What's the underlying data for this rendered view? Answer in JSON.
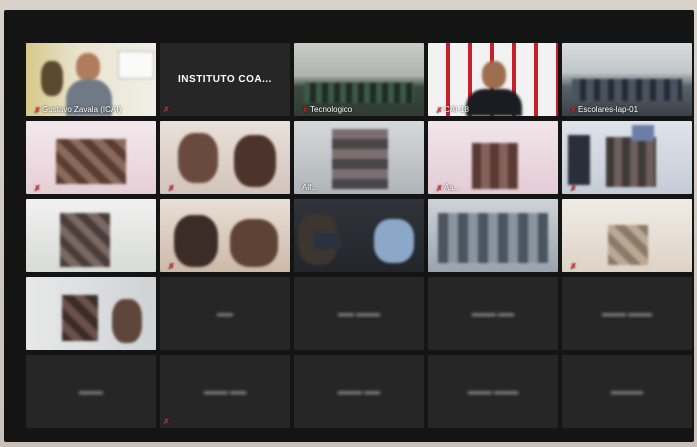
{
  "meeting": {
    "participants": [
      {
        "name": "Gustavo Zavala (ICAI)",
        "type": "video",
        "active": true,
        "muted": true
      },
      {
        "name": "INSTITUTO  COA...",
        "type": "name-only",
        "muted": true
      },
      {
        "name": "Tecnologico",
        "type": "video",
        "muted": true
      },
      {
        "name": "CAI-18",
        "type": "video",
        "muted": true
      },
      {
        "name": "Escolares-lap-01",
        "type": "video",
        "muted": true
      },
      {
        "name": "",
        "type": "video",
        "muted": true
      },
      {
        "name": "",
        "type": "video",
        "muted": true
      },
      {
        "name": "Alf...",
        "type": "video",
        "muted": false
      },
      {
        "name": "As...",
        "type": "video",
        "muted": true
      },
      {
        "name": "",
        "type": "video",
        "muted": true
      },
      {
        "name": "",
        "type": "video",
        "muted": false
      },
      {
        "name": "",
        "type": "video",
        "muted": true
      },
      {
        "name": "",
        "type": "video",
        "muted": false
      },
      {
        "name": "",
        "type": "video",
        "muted": false
      },
      {
        "name": "",
        "type": "video",
        "muted": true
      },
      {
        "name": "",
        "type": "video",
        "muted": false
      },
      {
        "name": "",
        "type": "blurred",
        "muted": false
      },
      {
        "name": "",
        "type": "blurred",
        "muted": false
      },
      {
        "name": "",
        "type": "blurred",
        "muted": false
      },
      {
        "name": "",
        "type": "blurred",
        "muted": false
      },
      {
        "name": "",
        "type": "blurred",
        "muted": false
      },
      {
        "name": "",
        "type": "blurred",
        "muted": true
      },
      {
        "name": "",
        "type": "blurred",
        "muted": false
      },
      {
        "name": "",
        "type": "blurred",
        "muted": false
      },
      {
        "name": "",
        "type": "blurred",
        "muted": false
      }
    ]
  },
  "colors": {
    "active_border": "#c9d75a",
    "mute_icon": "#e02a2a",
    "tile_bg": "#262626",
    "window_bg": "#141414"
  },
  "icons": {
    "mute": "microphone-muted-icon"
  }
}
